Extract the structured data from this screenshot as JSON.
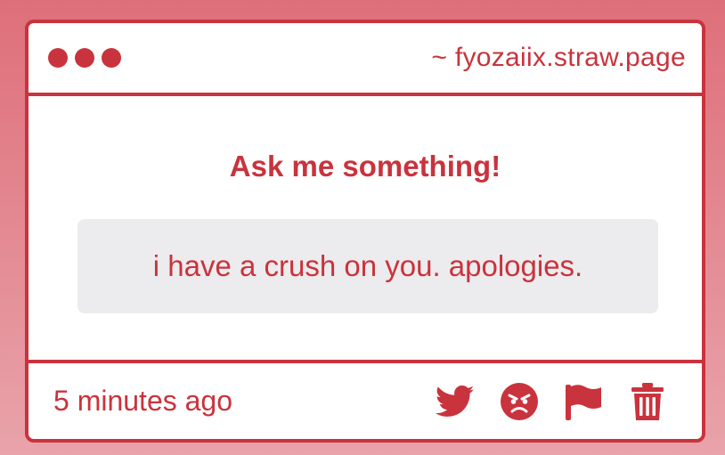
{
  "header": {
    "site_url": "~ fyozaiix.straw.page"
  },
  "main": {
    "title": "Ask me something!",
    "question": "i have a crush on you. apologies."
  },
  "footer": {
    "timestamp": "5 minutes ago",
    "actions": [
      "twitter-icon",
      "angry-face-icon",
      "flag-icon",
      "trash-icon"
    ]
  },
  "colors": {
    "accent": "#c9333d",
    "question_bg": "#ecebed",
    "background_top": "#de6f7a",
    "background_bottom": "#e9a3aa"
  }
}
